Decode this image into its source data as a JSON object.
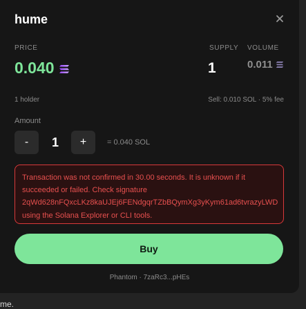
{
  "modal": {
    "title": "hume",
    "close_icon": "close-icon",
    "price": {
      "label": "PRICE",
      "value": "0.040",
      "currency_icon": "solana-icon"
    },
    "supply": {
      "label": "SUPPLY",
      "value": "1"
    },
    "volume": {
      "label": "VOLUME",
      "value": "0.011",
      "currency_icon": "solana-icon"
    },
    "holders": "1 holder",
    "sell_info": "Sell: 0.010 SOL · 5% fee",
    "amount": {
      "label": "Amount",
      "decrement_label": "-",
      "increment_label": "+",
      "quantity": "1",
      "equivalent": "= 0.040 SOL"
    },
    "error_message": "Transaction was not confirmed in 30.00 seconds. It is unknown if it\nsucceeded or failed. Check signature\n2qWd628nFQxcLKz8kaUJEj6FENdgqrTZbBQymXg3yKym61ad6tvrazyLWD\nusing the Solana Explorer or CLI tools.",
    "buy_label": "Buy",
    "wallet": "Phantom · 7zaRc3...pHEs"
  },
  "background_text": "me.",
  "colors": {
    "accent": "#7ee59a",
    "error": "#e8504f",
    "solana_gradient": [
      "#9945ff",
      "#14f195"
    ]
  }
}
